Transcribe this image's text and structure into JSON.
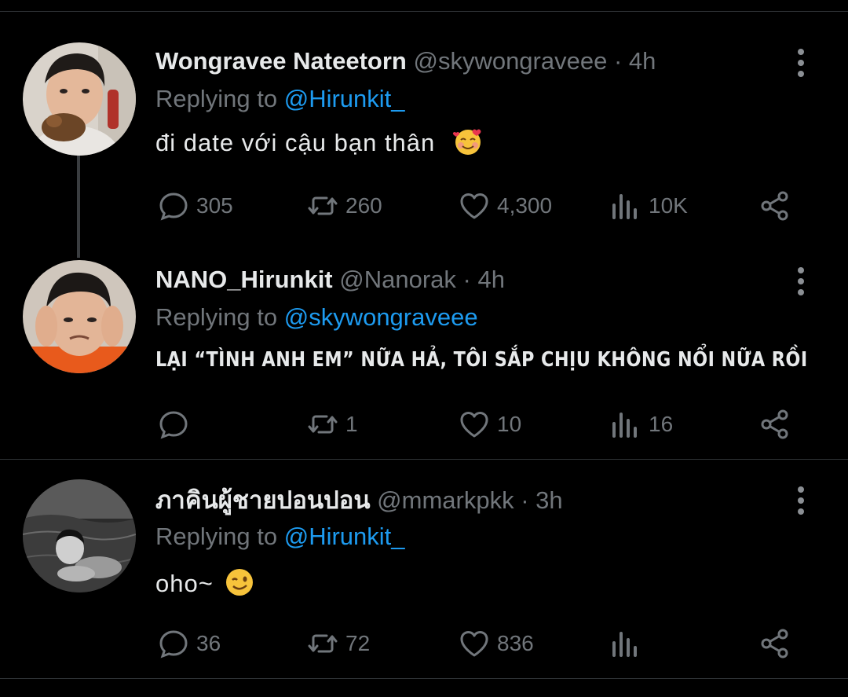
{
  "tweets": [
    {
      "name": "Wongravee Nateetorn",
      "handle": "@skywongraveee",
      "dot": "·",
      "time": "4h",
      "replying_prefix": "Replying to",
      "replying_to": "@Hirunkit_",
      "text": "đi date với cậu bạn thân",
      "emoji": "smiling-face-with-hearts",
      "replies": "305",
      "retweets": "260",
      "likes": "4,300",
      "views": "10K"
    },
    {
      "name": "NANO_Hirunkit",
      "handle": "@Nanorak",
      "dot": "·",
      "time": "4h",
      "replying_prefix": "Replying to",
      "replying_to": "@skywongraveee",
      "text": "LẠI “TÌNH ANH EM” NỮA HẢ, TÔI SẮP CHỊU KHÔNG NỔI NỮA RỒI",
      "replies": "",
      "retweets": "1",
      "likes": "10",
      "views": "16"
    },
    {
      "name": "ภาคินผู้ชายปอนปอน",
      "handle": "@mmarkpkk",
      "dot": "·",
      "time": "3h",
      "replying_prefix": "Replying to",
      "replying_to": "@Hirunkit_",
      "text": "oho~",
      "emoji": "winking-face",
      "replies": "36",
      "retweets": "72",
      "likes": "836",
      "views": ""
    }
  ],
  "colors": {
    "background": "#000000",
    "text": "#e7e9ea",
    "muted": "#71767b",
    "accent": "#1d9bf0",
    "divider": "#2f3336"
  },
  "icons": [
    "reply-icon",
    "retweet-icon",
    "like-icon",
    "views-icon",
    "share-icon",
    "more-icon"
  ]
}
